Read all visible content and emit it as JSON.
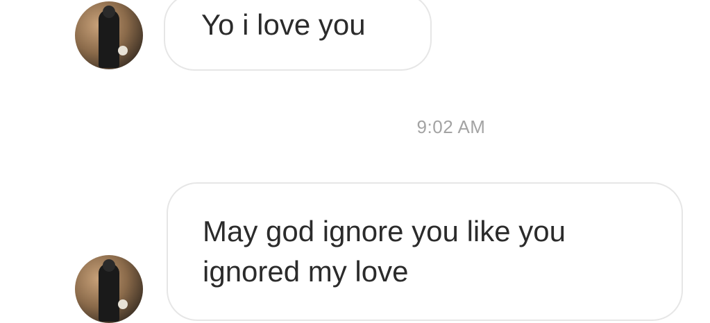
{
  "messages": [
    {
      "text": "Yo i love you"
    },
    {
      "text": "May god ignore you like you ignored my love"
    }
  ],
  "timestamp": "9:02 AM",
  "colors": {
    "bubble_border": "#e6e6e6",
    "text": "#2b2b2b",
    "timestamp": "#a3a3a3"
  }
}
